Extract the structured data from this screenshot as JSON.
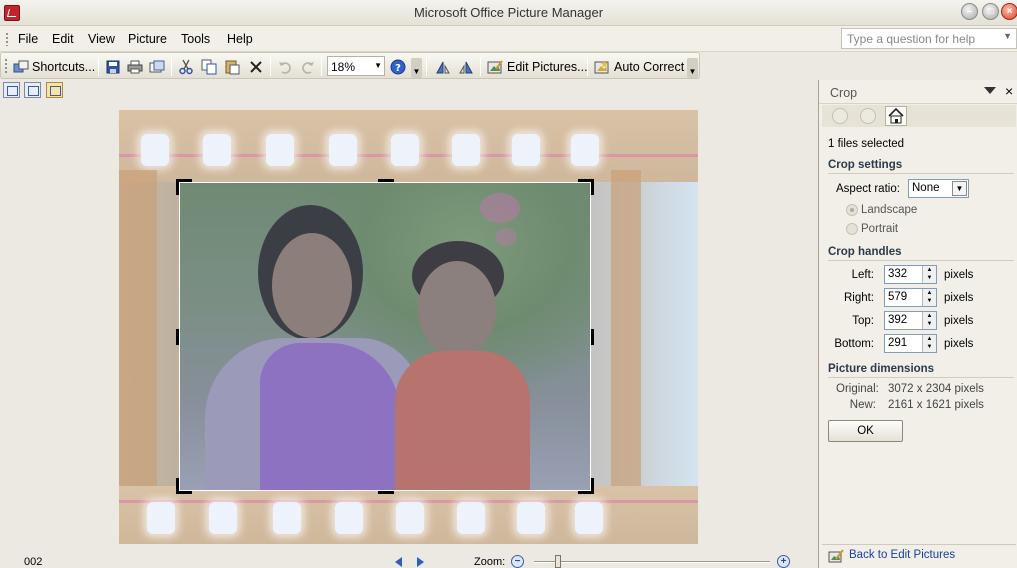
{
  "window": {
    "title": "Microsoft Office Picture Manager"
  },
  "menu": {
    "items": [
      "File",
      "Edit",
      "View",
      "Picture",
      "Tools",
      "Help"
    ]
  },
  "help_box": {
    "placeholder": "Type a question for help"
  },
  "toolbar": {
    "shortcuts_label": "Shortcuts...",
    "zoom_value": "18%",
    "edit_pictures_label": "Edit Pictures...",
    "auto_correct_label": "Auto Correct"
  },
  "status": {
    "filename": "002",
    "zoom_label": "Zoom:"
  },
  "pane": {
    "title": "Crop",
    "files_selected": "1 files selected",
    "crop_settings": {
      "heading": "Crop settings",
      "aspect_label": "Aspect ratio:",
      "aspect_value": "None",
      "landscape": "Landscape",
      "portrait": "Portrait"
    },
    "crop_handles": {
      "heading": "Crop handles",
      "left_label": "Left:",
      "left": "332",
      "right_label": "Right:",
      "right": "579",
      "top_label": "Top:",
      "top": "392",
      "bottom_label": "Bottom:",
      "bottom": "291",
      "unit": "pixels"
    },
    "dimensions": {
      "heading": "Picture dimensions",
      "original_label": "Original:",
      "original": "3072 x 2304 pixels",
      "new_label": "New:",
      "new": "2161 x 1621 pixels"
    },
    "ok_label": "OK",
    "back_link": "Back to Edit Pictures"
  },
  "colors": {
    "accent": "#1640a4",
    "title_close": "#d8442b"
  }
}
